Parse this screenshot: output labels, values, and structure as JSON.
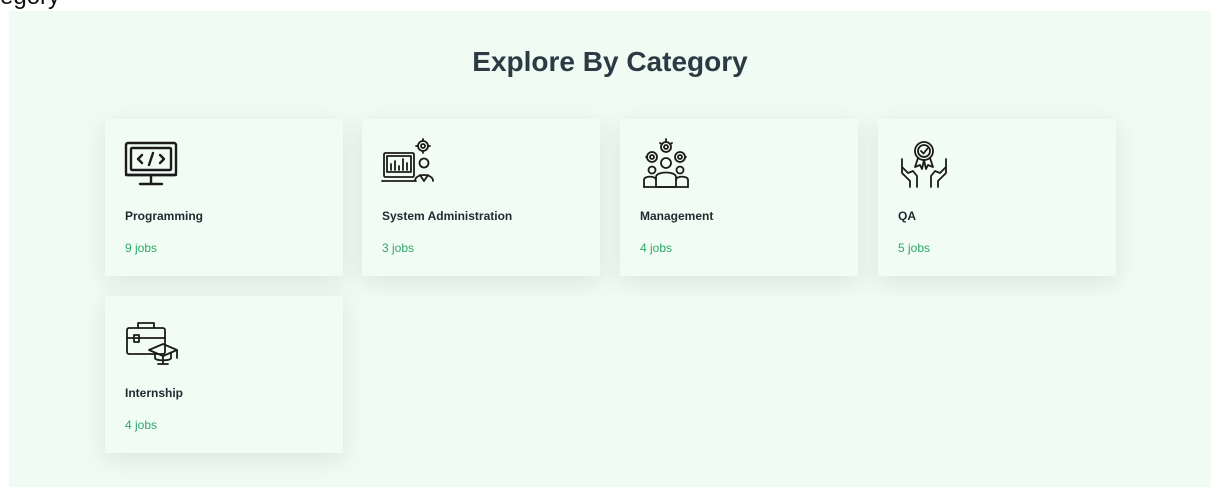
{
  "top_strip_text": "egory",
  "section": {
    "title": "Explore By Category",
    "categories": [
      {
        "name": "Programming",
        "count": "9 jobs",
        "icon": "code-monitor-icon"
      },
      {
        "name": "System Administration",
        "count": "3 jobs",
        "icon": "sysadmin-icon"
      },
      {
        "name": "Management",
        "count": "4 jobs",
        "icon": "management-gears-icon"
      },
      {
        "name": "QA",
        "count": "5 jobs",
        "icon": "quality-award-hands-icon"
      },
      {
        "name": "Internship",
        "count": "4 jobs",
        "icon": "briefcase-graduation-icon"
      }
    ]
  },
  "colors": {
    "section_bg": "#effbf3",
    "card_bg": "#f1fcf4",
    "title": "#2b3a43",
    "count": "#2fa86a"
  }
}
